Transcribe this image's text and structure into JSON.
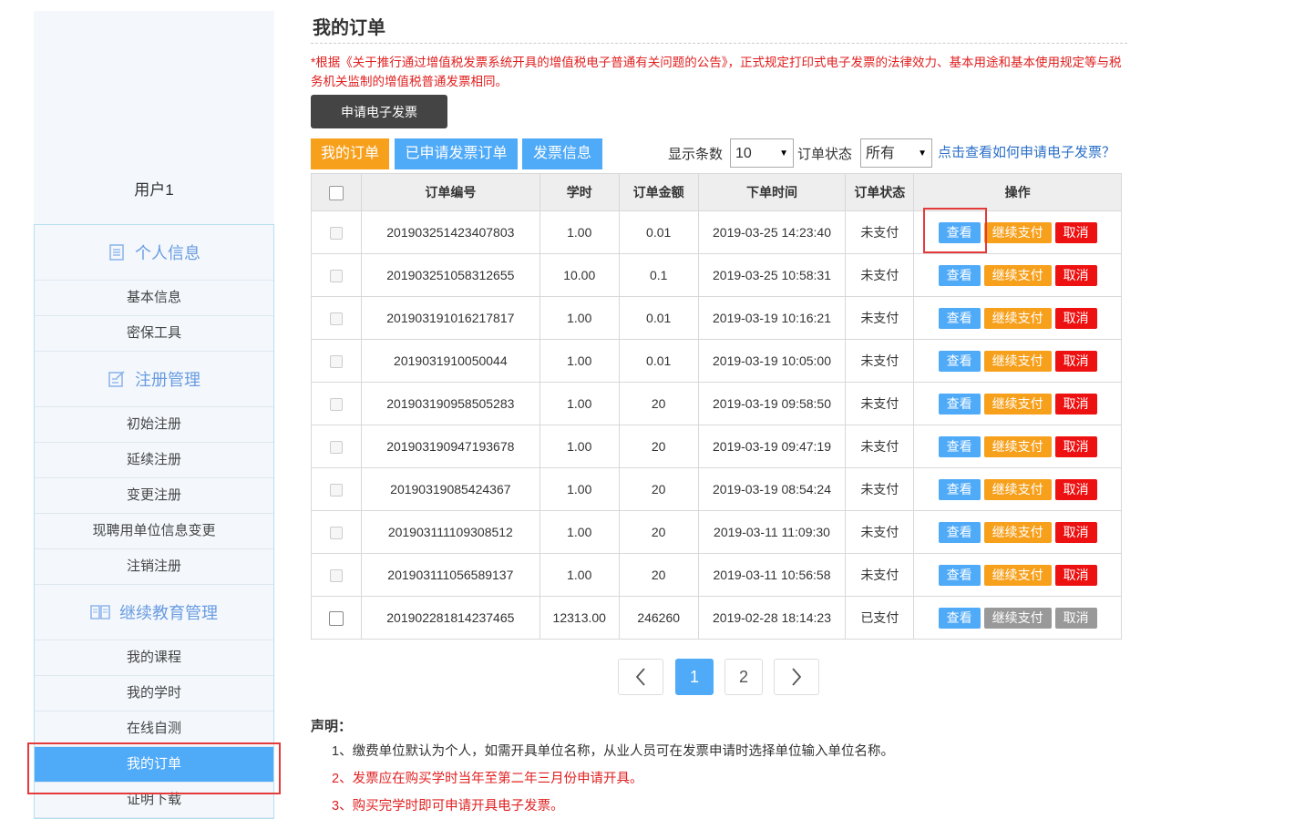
{
  "sidebar": {
    "username": "用户1",
    "groups": [
      {
        "title": "个人信息",
        "icon": "document-list-icon",
        "items": [
          "基本信息",
          "密保工具"
        ]
      },
      {
        "title": "注册管理",
        "icon": "edit-form-icon",
        "items": [
          "初始注册",
          "延续注册",
          "变更注册",
          "现聘用单位信息变更",
          "注销注册"
        ]
      },
      {
        "title": "继续教育管理",
        "icon": "open-book-icon",
        "items": [
          "我的课程",
          "我的学时",
          "在线自测",
          "我的订单",
          "证明下载"
        ]
      }
    ],
    "active_item": "我的订单"
  },
  "page": {
    "title": "我的订单",
    "notice": "*根据《关于推行通过增值税发票系统开具的增值税电子普通有关问题的公告》，正式规定打印式电子发票的法律效力、基本用途和基本使用规定等与税务机关监制的增值税普通发票相同。",
    "apply_button": "申请电子发票"
  },
  "tabs": [
    "我的订单",
    "已申请发票订单",
    "发票信息"
  ],
  "filters": {
    "page_size_label": "显示条数",
    "page_size_value": "10",
    "status_label": "订单状态",
    "status_value": "所有",
    "help_link": "点击查看如何申请电子发票？"
  },
  "table": {
    "headers": [
      "订单编号",
      "学时",
      "订单金额",
      "下单时间",
      "订单状态",
      "操作"
    ],
    "actions": {
      "view": "查看",
      "pay": "继续支付",
      "cancel": "取消"
    },
    "rows": [
      {
        "id": "201903251423407803",
        "hours": "1.00",
        "amount": "0.01",
        "time": "2019-03-25 14:23:40",
        "status": "未支付"
      },
      {
        "id": "201903251058312655",
        "hours": "10.00",
        "amount": "0.1",
        "time": "2019-03-25 10:58:31",
        "status": "未支付"
      },
      {
        "id": "201903191016217817",
        "hours": "1.00",
        "amount": "0.01",
        "time": "2019-03-19 10:16:21",
        "status": "未支付"
      },
      {
        "id": "2019031910050044",
        "hours": "1.00",
        "amount": "0.01",
        "time": "2019-03-19 10:05:00",
        "status": "未支付"
      },
      {
        "id": "201903190958505283",
        "hours": "1.00",
        "amount": "20",
        "time": "2019-03-19 09:58:50",
        "status": "未支付"
      },
      {
        "id": "201903190947193678",
        "hours": "1.00",
        "amount": "20",
        "time": "2019-03-19 09:47:19",
        "status": "未支付"
      },
      {
        "id": "20190319085424367",
        "hours": "1.00",
        "amount": "20",
        "time": "2019-03-19 08:54:24",
        "status": "未支付"
      },
      {
        "id": "201903111109308512",
        "hours": "1.00",
        "amount": "20",
        "time": "2019-03-11 11:09:30",
        "status": "未支付"
      },
      {
        "id": "201903111056589137",
        "hours": "1.00",
        "amount": "20",
        "time": "2019-03-11 10:56:58",
        "status": "未支付"
      },
      {
        "id": "201902281814237465",
        "hours": "12313.00",
        "amount": "246260",
        "time": "2019-02-28 18:14:23",
        "status": "已支付"
      }
    ]
  },
  "pagination": {
    "pages": [
      "1",
      "2"
    ],
    "current": "1",
    "prev_icon": "chevron-left-icon",
    "next_icon": "chevron-right-icon"
  },
  "declaration": {
    "title": "声明：",
    "items": [
      {
        "text": "1、缴费单位默认为个人，如需开具单位名称，从业人员可在发票申请时选择单位输入单位名称。",
        "color": "#333333"
      },
      {
        "text": "2、发票应在购买学时当年至第二年三月份申请开具。",
        "color": "#e02020"
      },
      {
        "text": "3、购买完学时即可申请开具电子发票。",
        "color": "#e02020"
      }
    ]
  },
  "colors": {
    "accent_blue": "#4faaf8",
    "accent_orange": "#f7a01c",
    "danger_red": "#ee1111",
    "highlight_red": "#e43a3a"
  }
}
